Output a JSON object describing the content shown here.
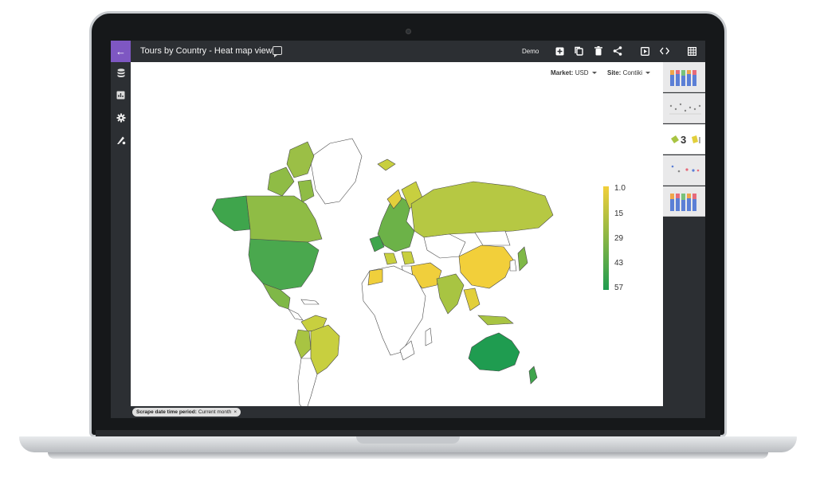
{
  "header": {
    "title": "Tours by Country - Heat map view",
    "env_label": "Demo"
  },
  "filters": {
    "market_label": "Market:",
    "market_value": "USD",
    "site_label": "Site:",
    "site_value": "Contiki"
  },
  "legend": {
    "ticks": [
      "1.0",
      "15",
      "29",
      "43",
      "57"
    ],
    "color_low": "#f2cf3a",
    "color_high": "#1f9c50"
  },
  "thumbnails": [
    {
      "kind": "stacked-bar"
    },
    {
      "kind": "scatter"
    },
    {
      "kind": "map",
      "label": "3",
      "active": true
    },
    {
      "kind": "dots"
    },
    {
      "kind": "stacked-bar"
    }
  ],
  "bottom": {
    "chip_label": "Scrape date time period:",
    "chip_value": "Current month",
    "chip_close": "×"
  },
  "icons": {
    "back": "arrow-left-icon",
    "comment": "comment-icon",
    "add": "add-box-icon",
    "copy": "copy-icon",
    "delete": "trash-icon",
    "share": "share-icon",
    "present": "play-box-icon",
    "code": "code-icon",
    "grid": "grid-icon",
    "database": "database-icon",
    "chart": "bar-chart-icon",
    "settings": "gear-icon",
    "style": "paint-icon",
    "filter": "filter-icon"
  },
  "colors": {
    "accent": "#7e57c2",
    "chrome": "#2c2f33"
  }
}
